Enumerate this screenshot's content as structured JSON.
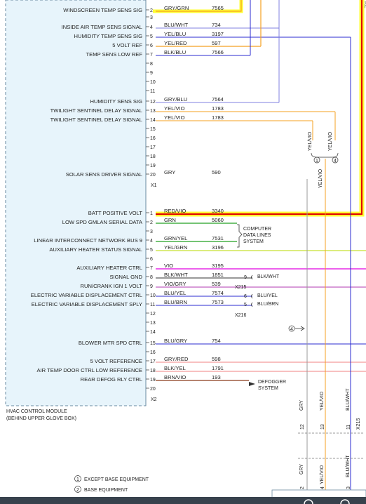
{
  "module": {
    "name_line1": "HVAC CONTROL MODULE",
    "name_line2": "(BEHIND UPPER GLOVE BOX)",
    "connector_x1": "X1",
    "connector_x2": "X2"
  },
  "x1_pins": [
    {
      "pin": "2",
      "label": "WINDSCREEN TEMP SENS SIG",
      "wire": "GRY/GRN",
      "circuit": "7565"
    },
    {
      "pin": "3",
      "label": "",
      "wire": "",
      "circuit": ""
    },
    {
      "pin": "4",
      "label": "INSIDE AIR TEMP SENS SIGNAL",
      "wire": "BLU/WHT",
      "circuit": "734"
    },
    {
      "pin": "5",
      "label": "HUMIDITY TEMP SENS SIG",
      "wire": "YEL/BLU",
      "circuit": "3197"
    },
    {
      "pin": "6",
      "label": "5 VOLT REF",
      "wire": "YEL/RED",
      "circuit": "597"
    },
    {
      "pin": "7",
      "label": "TEMP SENS LOW REF",
      "wire": "BLK/BLU",
      "circuit": "7566"
    },
    {
      "pin": "8",
      "label": "",
      "wire": "",
      "circuit": ""
    },
    {
      "pin": "9",
      "label": "",
      "wire": "",
      "circuit": ""
    },
    {
      "pin": "10",
      "label": "",
      "wire": "",
      "circuit": ""
    },
    {
      "pin": "11",
      "label": "",
      "wire": "",
      "circuit": ""
    },
    {
      "pin": "12",
      "label": "HUMIDITY SENS SIG",
      "wire": "GRY/BLU",
      "circuit": "7564"
    },
    {
      "pin": "13",
      "label": "TWILIGHT SENTINEL DELAY SIGNAL",
      "wire": "YEL/VIO",
      "circuit": "1783"
    },
    {
      "pin": "14",
      "label": "TWILIGHT SENTINEL DELAY SIGNAL",
      "wire": "YEL/VIO",
      "circuit": "1783"
    },
    {
      "pin": "15",
      "label": "",
      "wire": "",
      "circuit": ""
    },
    {
      "pin": "16",
      "label": "",
      "wire": "",
      "circuit": ""
    },
    {
      "pin": "17",
      "label": "",
      "wire": "",
      "circuit": ""
    },
    {
      "pin": "18",
      "label": "",
      "wire": "",
      "circuit": ""
    },
    {
      "pin": "19",
      "label": "",
      "wire": "",
      "circuit": ""
    },
    {
      "pin": "20",
      "label": "SOLAR SENS DRIVER SIGNAL",
      "wire": "GRY",
      "circuit": "590"
    }
  ],
  "x2_pins": [
    {
      "pin": "1",
      "label": "BATT POSITIVE VOLT",
      "wire": "RED/VIO",
      "circuit": "3340"
    },
    {
      "pin": "2",
      "label": "LOW SPD GMLAN SERIAL DATA",
      "wire": "GRN",
      "circuit": "5060"
    },
    {
      "pin": "3",
      "label": "",
      "wire": "",
      "circuit": ""
    },
    {
      "pin": "4",
      "label": "LINEAR INTERCONNECT NETWORK BUS 9",
      "wire": "GRN/YEL",
      "circuit": "7531"
    },
    {
      "pin": "5",
      "label": "AUXILIARY HEATER STATUS SIGNAL",
      "wire": "YEL/GRN",
      "circuit": "3196"
    },
    {
      "pin": "6",
      "label": "",
      "wire": "",
      "circuit": ""
    },
    {
      "pin": "7",
      "label": "AUXILIARY HEATER CTRL",
      "wire": "VIO",
      "circuit": "3195"
    },
    {
      "pin": "8",
      "label": "SIGNAL GND",
      "wire": "BLK/WHT",
      "circuit": "1851"
    },
    {
      "pin": "9",
      "label": "RUN/CRANK IGN 1 VOLT",
      "wire": "VIO/GRY",
      "circuit": "539"
    },
    {
      "pin": "10",
      "label": "ELECTRIC VARIABLE DISPLACEMENT CTRL",
      "wire": "BLU/YEL",
      "circuit": "7574"
    },
    {
      "pin": "11",
      "label": "ELECTRIC VARIABLE DISPLACEMENT SPLY",
      "wire": "BLU/BRN",
      "circuit": "7573"
    },
    {
      "pin": "12",
      "label": "",
      "wire": "",
      "circuit": ""
    },
    {
      "pin": "13",
      "label": "",
      "wire": "",
      "circuit": ""
    },
    {
      "pin": "14",
      "label": "",
      "wire": "",
      "circuit": ""
    },
    {
      "pin": "15",
      "label": "BLOWER MTR SPD CTRL",
      "wire": "BLU/GRY",
      "circuit": "754"
    },
    {
      "pin": "16",
      "label": "",
      "wire": "",
      "circuit": ""
    },
    {
      "pin": "17",
      "label": "5 VOLT REFERENCE",
      "wire": "GRY/RED",
      "circuit": "598"
    },
    {
      "pin": "18",
      "label": "AIR TEMP DOOR CTRL LOW REFERENCE",
      "wire": "BLK/YEL",
      "circuit": "1791"
    },
    {
      "pin": "19",
      "label": "REAR DEFOG RLY CTRL",
      "wire": "BRN/VIO",
      "circuit": "193"
    },
    {
      "pin": "20",
      "label": "",
      "wire": "",
      "circuit": ""
    }
  ],
  "annotations": {
    "computer_data_lines": [
      "COMPUTER",
      "DATA LINES",
      "SYSTEM"
    ],
    "defogger": [
      "DEFOGGER",
      "SYSTEM"
    ],
    "x215": "X215",
    "x216": "X216",
    "splice_9_pin": "9",
    "splice_9_wire": "BLK/WHT",
    "splice_6_pin": "6",
    "splice_6_wire": "BLU/YEL",
    "splice_5_pin": "5",
    "splice_5_wire": "BLU/BRN",
    "ref4": "4",
    "twilight_top_left": "YEL/VIO",
    "twilight_top_right": "YEL/VIO",
    "twilight_mid": "YEL/VIO",
    "circle1": "1",
    "circle4": "4",
    "bottom_wires": [
      {
        "wire": "GRY",
        "pin_top": "12",
        "pin_bottom": "2",
        "wire_bottom": "GRY"
      },
      {
        "wire": "YEL/VIO",
        "pin_top": "13",
        "pin_bottom": "4",
        "wire_bottom": "YEL/VIO"
      },
      {
        "wire": "BLU/WHT",
        "pin_top": "11",
        "pin_bottom": "3",
        "wire_bottom": "BLU/WHT"
      }
    ],
    "x215_bottom": "X215",
    "right_edge_label": "RE"
  },
  "legend": {
    "item1_num": "1",
    "item1_text": "EXCEPT BASE EQUIPMENT",
    "item2_num": "2",
    "item2_text": "BASE EQUIPMENT"
  },
  "colors": {
    "module_fill": "#e7f4fb",
    "batt_red": "#e00000",
    "highlight_yellow": "#ffff33",
    "orange": "#f5a020",
    "blue": "#2b2bd0",
    "light_blue": "#8080e0",
    "green": "#20a020",
    "lime": "#c8e030",
    "magenta": "#e000e0",
    "violet": "#c060c0",
    "gray": "#9a9a9a",
    "salmon": "#f08080",
    "brown": "#8b3a1a",
    "footer": "#38424d"
  }
}
